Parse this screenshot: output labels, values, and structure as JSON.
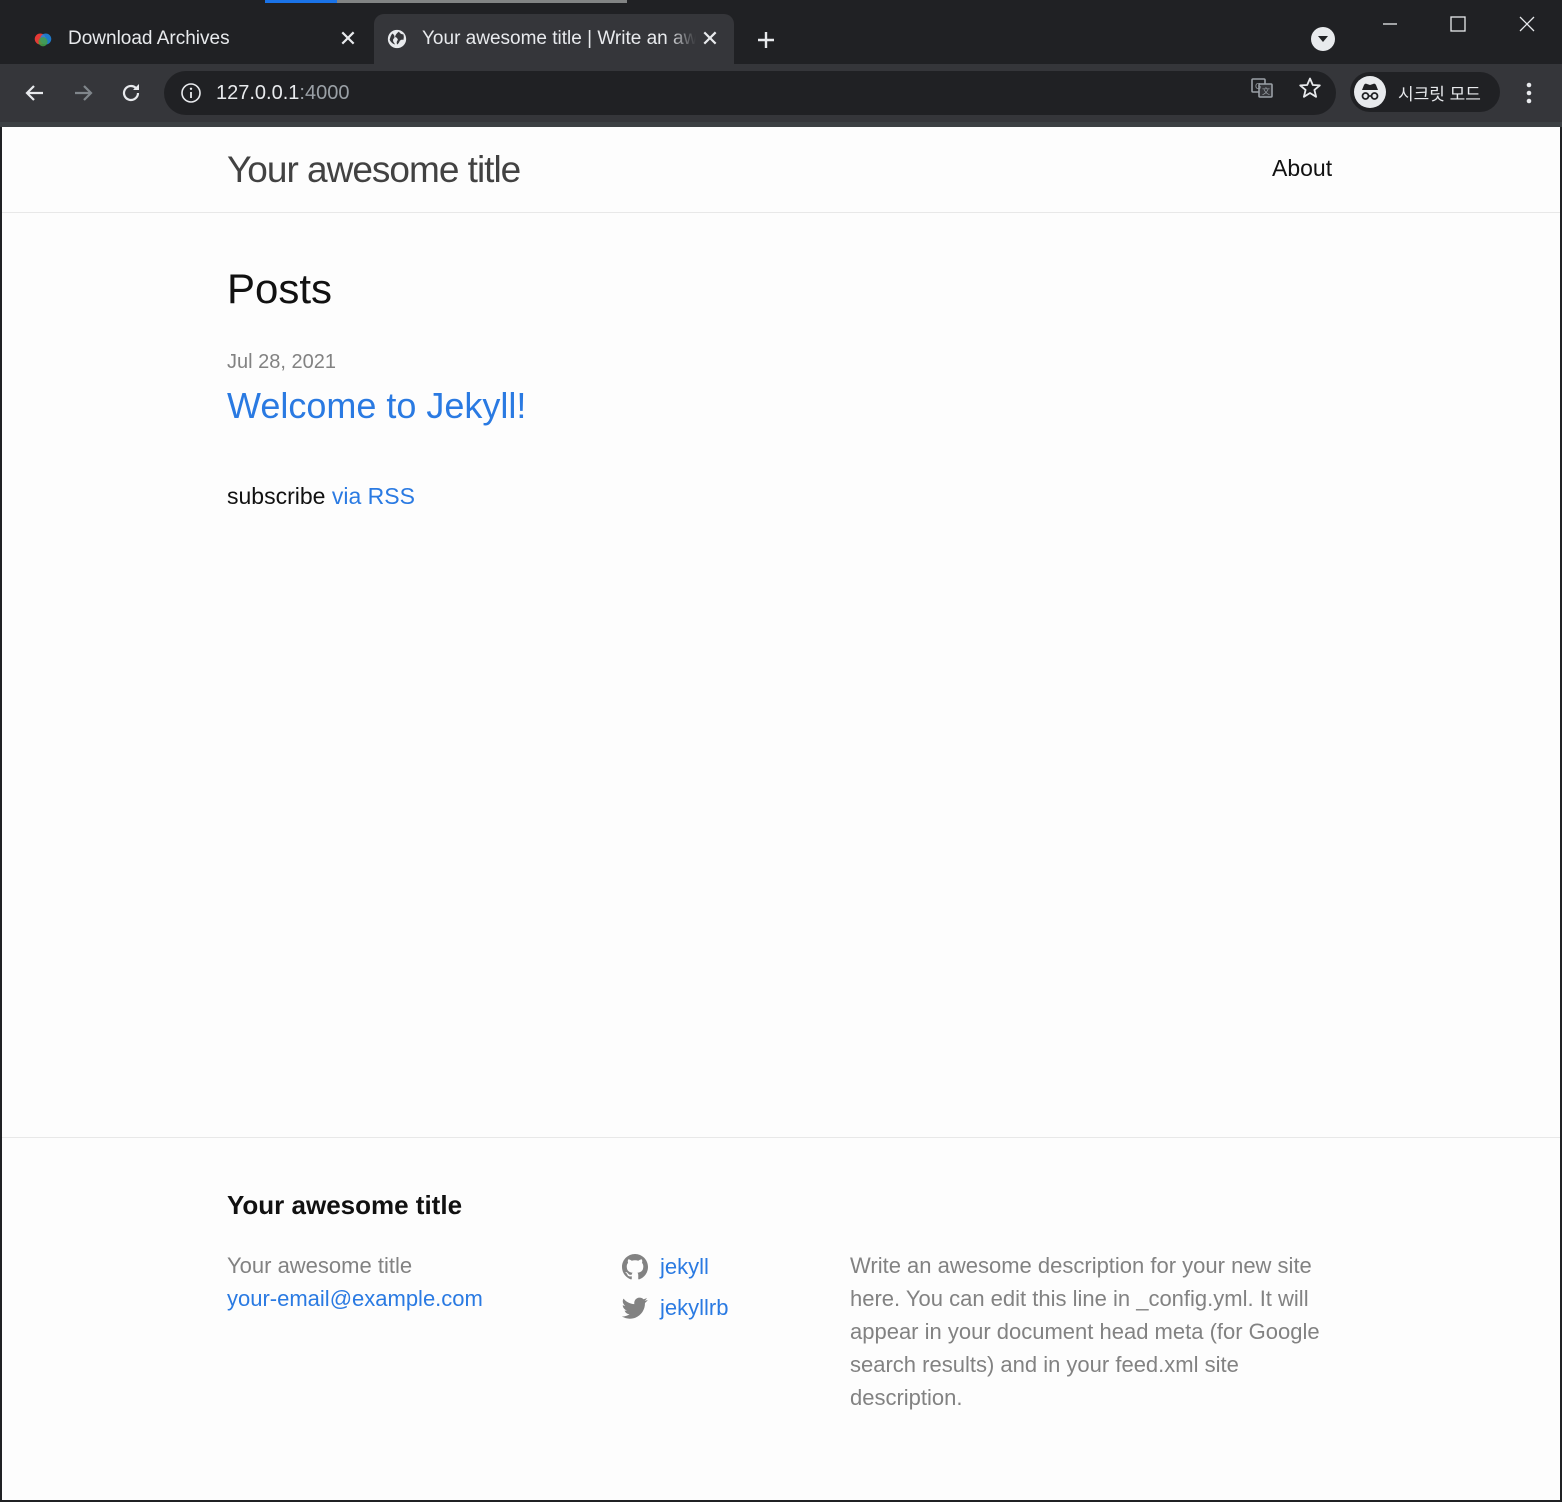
{
  "browser": {
    "tabs": [
      {
        "title": "Download Archives",
        "active": false
      },
      {
        "title": "Your awesome title | Write an awesome description",
        "active": true
      }
    ],
    "address": {
      "host": "127.0.0.1",
      "port": ":4000"
    },
    "incognito_label": "시크릿 모드",
    "colors": {
      "frame": "#202124",
      "toolbar": "#35363a",
      "accent": "#1a73e8"
    }
  },
  "site": {
    "title": "Your awesome title",
    "nav": {
      "about": "About"
    },
    "page_heading": "Posts",
    "posts": [
      {
        "date": "Jul 28, 2021",
        "title": "Welcome to Jekyll!"
      }
    ],
    "rss": {
      "prefix": "subscribe",
      "link": "via RSS"
    },
    "footer": {
      "heading": "Your awesome title",
      "name": "Your awesome title",
      "email": "your-email@example.com",
      "social": [
        {
          "icon": "github-icon",
          "label": "jekyll"
        },
        {
          "icon": "twitter-icon",
          "label": "jekyllrb"
        }
      ],
      "description": "Write an awesome description for your new site here. You can edit this line in _config.yml. It will appear in your document head meta (for Google search results) and in your feed.xml site description."
    },
    "colors": {
      "link": "#2a7ae2",
      "meta": "#828282",
      "text": "#111111"
    }
  }
}
